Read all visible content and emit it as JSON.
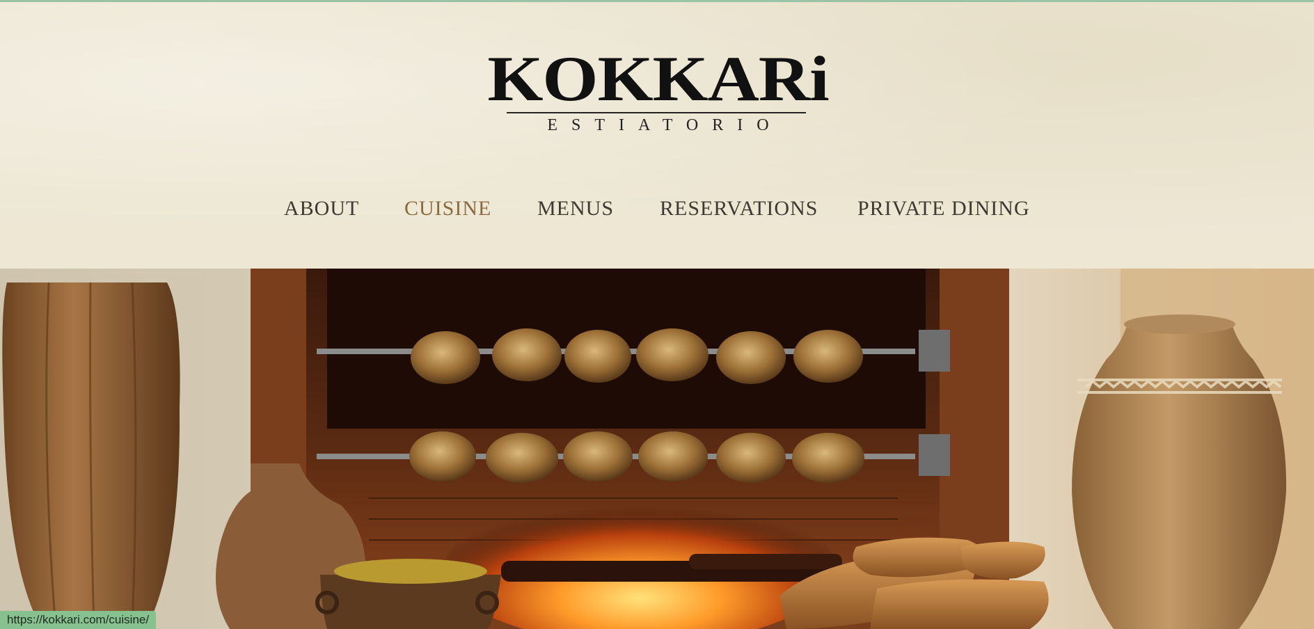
{
  "logo": {
    "name": "KOKKARi",
    "tagline": "ESTIATORIO"
  },
  "nav": {
    "items": [
      {
        "label": "ABOUT"
      },
      {
        "label": "CUISINE"
      },
      {
        "label": "MENUS"
      },
      {
        "label": "RESERVATIONS"
      },
      {
        "label": "PRIVATE DINING"
      }
    ],
    "active_color": "#8b6a3e"
  },
  "status": {
    "url": "https://kokkari.com/cuisine/"
  }
}
